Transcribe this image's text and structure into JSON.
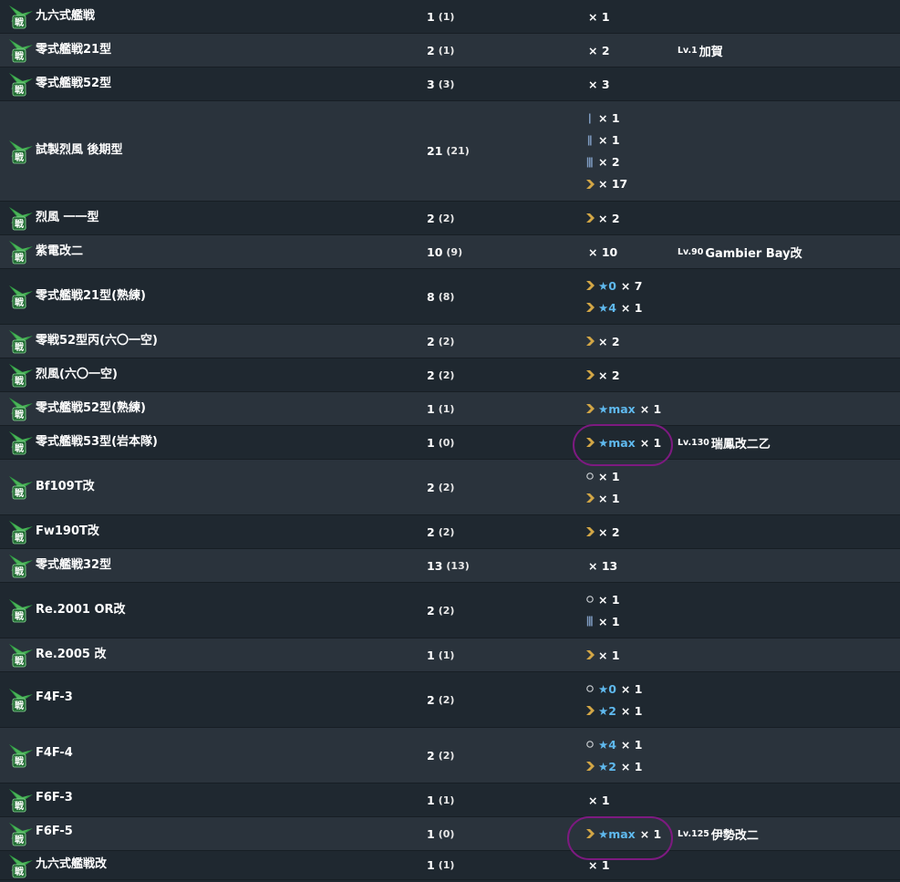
{
  "colors": {
    "row_dark": "#1f2830",
    "row_light": "#2a333c",
    "text": "#ffffff",
    "star": "#5fb9ee",
    "proficiency_chevron": "#d2a646",
    "proficiency_bar": "#7e9bc0",
    "icon_green": "#2f9a43",
    "annotation": "#7d1a80"
  },
  "rows": [
    {
      "name": "九六式艦戦",
      "count": "1",
      "count_sub": "(1)",
      "prof": [
        {
          "icon": "none",
          "star": "",
          "qty": "× 1"
        }
      ],
      "owner_lv": "",
      "owner_name": ""
    },
    {
      "name": "零式艦戦21型",
      "count": "2",
      "count_sub": "(1)",
      "prof": [
        {
          "icon": "none",
          "star": "",
          "qty": "× 2"
        }
      ],
      "owner_lv": "Lv.1",
      "owner_name": "加賀"
    },
    {
      "name": "零式艦戦52型",
      "count": "3",
      "count_sub": "(3)",
      "prof": [
        {
          "icon": "none",
          "star": "",
          "qty": "× 3"
        }
      ],
      "owner_lv": "",
      "owner_name": ""
    },
    {
      "name": "試製烈風 後期型",
      "count": "21",
      "count_sub": "(21)",
      "prof": [
        {
          "icon": "bar1",
          "star": "",
          "qty": "× 1"
        },
        {
          "icon": "bar2",
          "star": "",
          "qty": "× 1"
        },
        {
          "icon": "bar3",
          "star": "",
          "qty": "× 2"
        },
        {
          "icon": "chevron",
          "star": "",
          "qty": "× 17"
        }
      ],
      "owner_lv": "",
      "owner_name": ""
    },
    {
      "name": "烈風 一一型",
      "count": "2",
      "count_sub": "(2)",
      "prof": [
        {
          "icon": "chevron",
          "star": "",
          "qty": "× 2"
        }
      ],
      "owner_lv": "",
      "owner_name": ""
    },
    {
      "name": "紫電改二",
      "count": "10",
      "count_sub": "(9)",
      "prof": [
        {
          "icon": "none",
          "star": "",
          "qty": "× 10"
        }
      ],
      "owner_lv": "Lv.90",
      "owner_name": "Gambier Bay改"
    },
    {
      "name": "零式艦戦21型(熟練)",
      "count": "8",
      "count_sub": "(8)",
      "prof": [
        {
          "icon": "chevron",
          "star": "★0",
          "qty": "× 7"
        },
        {
          "icon": "chevron",
          "star": "★4",
          "qty": "× 1"
        }
      ],
      "owner_lv": "",
      "owner_name": ""
    },
    {
      "name": "零戦52型丙(六〇一空)",
      "count": "2",
      "count_sub": "(2)",
      "prof": [
        {
          "icon": "chevron",
          "star": "",
          "qty": "× 2"
        }
      ],
      "owner_lv": "",
      "owner_name": ""
    },
    {
      "name": "烈風(六〇一空)",
      "count": "2",
      "count_sub": "(2)",
      "prof": [
        {
          "icon": "chevron",
          "star": "",
          "qty": "× 2"
        }
      ],
      "owner_lv": "",
      "owner_name": ""
    },
    {
      "name": "零式艦戦52型(熟練)",
      "count": "1",
      "count_sub": "(1)",
      "prof": [
        {
          "icon": "chevron",
          "star": "★max",
          "qty": "× 1"
        }
      ],
      "owner_lv": "",
      "owner_name": ""
    },
    {
      "name": "零式艦戦53型(岩本隊)",
      "count": "1",
      "count_sub": "(0)",
      "prof": [
        {
          "icon": "chevron",
          "star": "★max",
          "qty": "× 1"
        }
      ],
      "owner_lv": "Lv.130",
      "owner_name": "瑞鳳改二乙"
    },
    {
      "name": "Bf109T改",
      "count": "2",
      "count_sub": "(2)",
      "prof": [
        {
          "icon": "circle",
          "star": "",
          "qty": "× 1"
        },
        {
          "icon": "chevron",
          "star": "",
          "qty": "× 1"
        }
      ],
      "owner_lv": "",
      "owner_name": ""
    },
    {
      "name": "Fw190T改",
      "count": "2",
      "count_sub": "(2)",
      "prof": [
        {
          "icon": "chevron",
          "star": "",
          "qty": "× 2"
        }
      ],
      "owner_lv": "",
      "owner_name": ""
    },
    {
      "name": "零式艦戦32型",
      "count": "13",
      "count_sub": "(13)",
      "prof": [
        {
          "icon": "none",
          "star": "",
          "qty": "× 13"
        }
      ],
      "owner_lv": "",
      "owner_name": ""
    },
    {
      "name": "Re.2001 OR改",
      "count": "2",
      "count_sub": "(2)",
      "prof": [
        {
          "icon": "circle",
          "star": "",
          "qty": "× 1"
        },
        {
          "icon": "bar3",
          "star": "",
          "qty": "× 1"
        }
      ],
      "owner_lv": "",
      "owner_name": ""
    },
    {
      "name": "Re.2005 改",
      "count": "1",
      "count_sub": "(1)",
      "prof": [
        {
          "icon": "chevron",
          "star": "",
          "qty": "× 1"
        }
      ],
      "owner_lv": "",
      "owner_name": ""
    },
    {
      "name": "F4F-3",
      "count": "2",
      "count_sub": "(2)",
      "prof": [
        {
          "icon": "circle",
          "star": "★0",
          "qty": "× 1"
        },
        {
          "icon": "chevron",
          "star": "★2",
          "qty": "× 1"
        }
      ],
      "owner_lv": "",
      "owner_name": ""
    },
    {
      "name": "F4F-4",
      "count": "2",
      "count_sub": "(2)",
      "prof": [
        {
          "icon": "circle",
          "star": "★4",
          "qty": "× 1"
        },
        {
          "icon": "chevron",
          "star": "★2",
          "qty": "× 1"
        }
      ],
      "owner_lv": "",
      "owner_name": ""
    },
    {
      "name": "F6F-3",
      "count": "1",
      "count_sub": "(1)",
      "prof": [
        {
          "icon": "none",
          "star": "",
          "qty": "× 1"
        }
      ],
      "owner_lv": "",
      "owner_name": ""
    },
    {
      "name": "F6F-5",
      "count": "1",
      "count_sub": "(0)",
      "prof": [
        {
          "icon": "chevron",
          "star": "★max",
          "qty": "× 1"
        }
      ],
      "owner_lv": "Lv.125",
      "owner_name": "伊勢改二"
    },
    {
      "name": "九六式艦戦改",
      "count": "1",
      "count_sub": "(1)",
      "prof": [
        {
          "icon": "none",
          "star": "",
          "qty": "× 1"
        }
      ],
      "owner_lv": "",
      "owner_name": ""
    }
  ]
}
